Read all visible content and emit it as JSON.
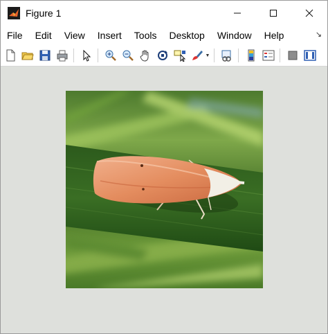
{
  "window": {
    "title": "Figure 1",
    "controls": {
      "minimize": "—",
      "maximize": "☐",
      "close": "✕"
    }
  },
  "menubar": {
    "items": [
      "File",
      "Edit",
      "View",
      "Insert",
      "Tools",
      "Desktop",
      "Window",
      "Help"
    ],
    "dock_glyph": "↘"
  },
  "toolbar": {
    "icons": [
      "new-figure-icon",
      "open-file-icon",
      "save-icon",
      "print-icon",
      "edit-plot-arrow-icon",
      "zoom-in-icon",
      "zoom-out-icon",
      "pan-hand-icon",
      "rotate-3d-icon",
      "data-cursor-icon",
      "brush-icon",
      "link-plot-icon",
      "insert-colorbar-icon",
      "insert-legend-icon",
      "hide-plot-tools-icon",
      "show-plot-tools-icon"
    ]
  },
  "colors": {
    "figure_background": "#dee0dc",
    "window_background": "#ffffff"
  },
  "image": {
    "subject": "moth on green leaf blade",
    "palette": {
      "leaf": "#2f5a1f",
      "moth_wing": "#e8956a",
      "moth_head": "#f2efe6"
    }
  }
}
